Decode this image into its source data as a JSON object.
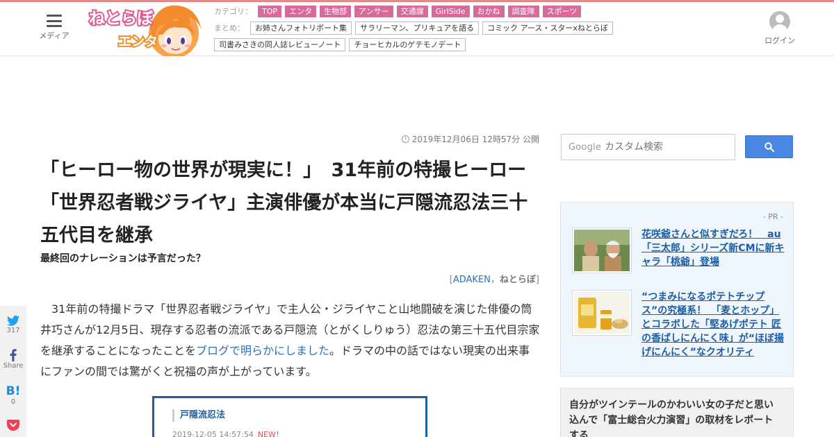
{
  "header": {
    "menu_label": "メディア",
    "logo_text": "ねとらぼ",
    "logo_sub": "エンタ",
    "category_label": "カテゴリ：",
    "categories": [
      "TOP",
      "エンタ",
      "生物部",
      "アンサー",
      "交通課",
      "GirlSide",
      "おかね",
      "調査隊",
      "スポーツ"
    ],
    "summary_label": "まとめ：",
    "summaries": [
      "お姉さんフォトリポート集",
      "サラリーマン、プリキュアを語る",
      "コミック アース・スターxねとらぼ",
      "司書みさきの同人誌レビューノート",
      "チョーヒカルのゲテモノデート"
    ],
    "login_label": "ログイン"
  },
  "article": {
    "date": "2019年12月06日 12時57分 公開",
    "title": "「ヒーロー物の世界が現実に！」　31年前の特撮ヒーロー「世界忍者戦ジライヤ」主演俳優が本当に戸隠流忍法三十五代目を継承",
    "subtitle": "最終回のナレーションは予言だった？",
    "byline_open": "[",
    "author": "ADAKEN",
    "byline_sep": "，",
    "publisher": "ねとらぼ",
    "byline_close": "]",
    "body_pre": "31年前の特撮ドラマ「世界忍者戦ジライヤ」で主人公・ジライヤこと山地闘破を演じた俳優の筒井巧さんが12月5日、現存する忍者の流派である戸隠流（とがくしりゅう）忍法の第三十五代目宗家を継承することになったことを",
    "body_link": "ブログで明らかにしました",
    "body_post": "。ドラマの中の話ではない現実の出来事にファンの間では驚がくと祝福の声が上がっています。",
    "figure": {
      "title": "戸隠流忍法",
      "date": "2019-12-05 14:57:54",
      "new_badge": "NEW！"
    }
  },
  "share": {
    "twitter_count": "317",
    "facebook_label": "Share",
    "hatena_glyph": "B!",
    "hatena_count": "0"
  },
  "sidebar": {
    "search": {
      "brand": "Google",
      "placeholder": "カスタム検索"
    },
    "pr": {
      "label": "- PR -",
      "items": [
        {
          "text": "花咲爺さんと似すぎだろ！　au「三太郎」シリーズ新CMに新キャラ「桃爺」登場"
        },
        {
          "text": "“つまみになるポテトチップス”の究極系！　「麦とホップ」とコラボした「堅あげポテト 匠の香ばしにんにく味」が“ほぼ揚げにんにく”なクオリティ"
        }
      ]
    },
    "ranking_text": "自分がツインテールのかわいい女の子だと思い込んで「富士総合火力演習」の取材をレポートする"
  },
  "colors": {
    "accent_pink": "#d86a9a",
    "link_blue": "#2a70b8",
    "search_blue": "#4a87e3",
    "top_bar": "#e08a8a"
  }
}
